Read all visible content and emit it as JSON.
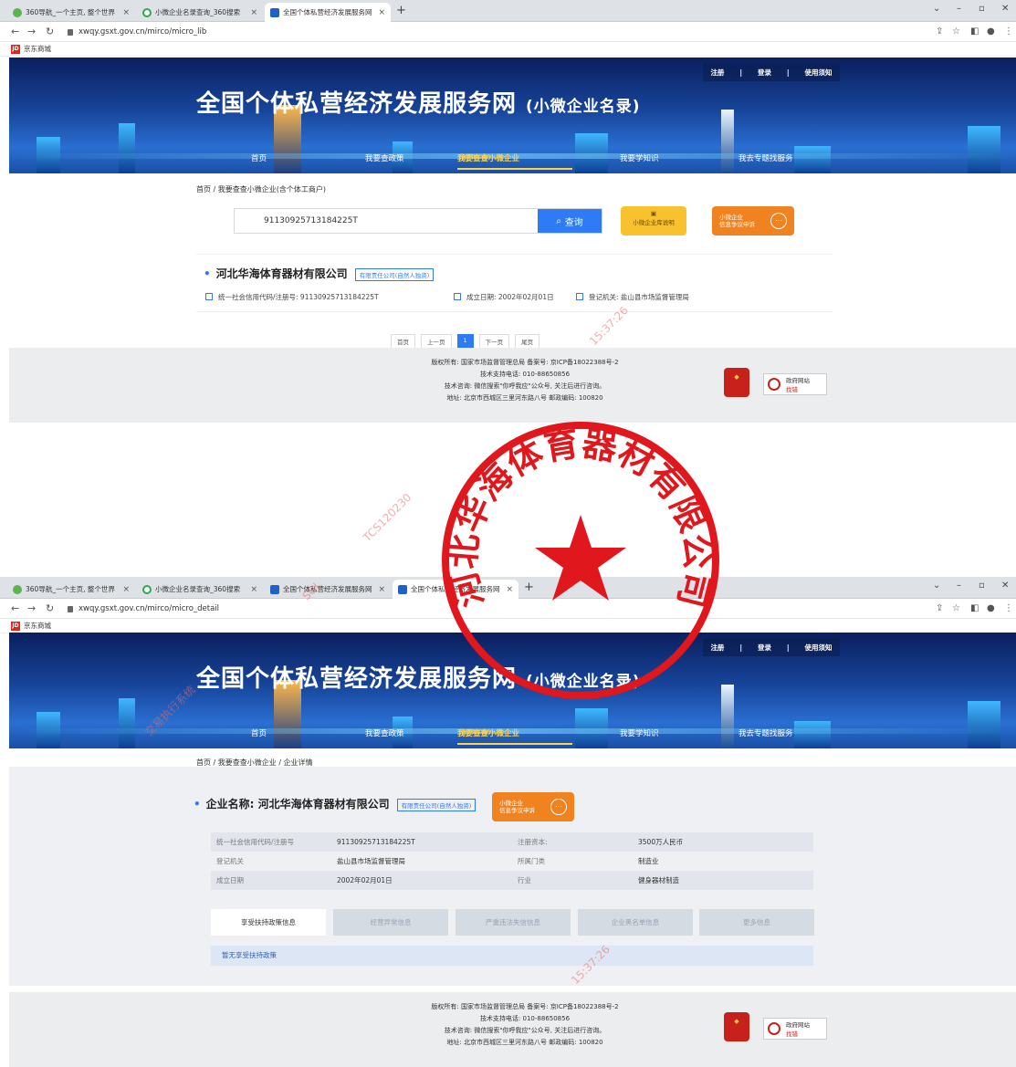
{
  "screen1": {
    "tabs": [
      {
        "title": "360导航_一个主页, 整个世界"
      },
      {
        "title": "小微企业名录查询_360搜索"
      },
      {
        "title": "全国个体私营经济发展服务网"
      }
    ],
    "url": "xwqy.gsxt.gov.cn/mirco/micro_lib",
    "breadcrumb": "首页 / 我要查查小微企业(含个体工商户)",
    "search_value": "91130925713184225T",
    "search_button": "查询",
    "lib_button": "小微企业库说明",
    "result": {
      "name": "河北华海体育器材有限公司",
      "tag": "有限责任公司(自然人独资)",
      "credit_code": "统一社会信用代码/注册号: 91130925713184225T",
      "founded": "成立日期: 2002年02月01日",
      "authority": "登记机关: 盐山县市场监督管理局"
    },
    "pager": {
      "first": "首页",
      "prev": "上一页",
      "current": "1",
      "next": "下一页",
      "last": "尾页"
    }
  },
  "screen2": {
    "tabs": [
      {
        "title": "360导航_一个主页, 整个世界"
      },
      {
        "title": "小微企业名录查询_360搜索"
      },
      {
        "title": "全国个体私营经济发展服务网"
      },
      {
        "title": "全国个体私营经济发展服务网"
      }
    ],
    "url": "xwqy.gsxt.gov.cn/mirco/micro_detail",
    "breadcrumb": "首页 / 我要查查小微企业 / 企业详情",
    "company_name": "企业名称: 河北华海体育器材有限公司",
    "tag": "有限责任公司(自然人独资)",
    "details": {
      "credit_label": "统一社会信用代码/注册号",
      "credit_value": "91130925713184225T",
      "capital_label": "注册资本:",
      "capital_value": "3500万人民币",
      "authority_label": "登记机关",
      "authority_value": "盐山县市场监督管理局",
      "category_label": "所属门类",
      "category_value": "制造业",
      "founded_label": "成立日期",
      "founded_value": "2002年02月01日",
      "industry_label": "行业",
      "industry_value": "健身器材制造"
    },
    "detail_tabs": [
      "享受扶持政策信息",
      "经营异常信息",
      "严重违法失信信息",
      "企业黑名单信息",
      "更多信息"
    ],
    "policy_empty": "暂无享受扶持政策"
  },
  "site": {
    "title": "全国个体私营经济发展服务网",
    "subtitle": "(小微企业名录)",
    "top_links": [
      "注册",
      "登录",
      "使用须知"
    ],
    "nav": [
      "首页",
      "我要查政策",
      "我要查查小微企业",
      "我要学知识",
      "我去专题找服务"
    ],
    "nav_small": "(含个体工商户)",
    "dispute_button": [
      "小微企业",
      "信息争议申诉"
    ],
    "bookmark": "京东商城"
  },
  "footer": {
    "lines": [
      "版权所有: 国家市场监督管理总局 备案号: 京ICP备18022388号-2",
      "技术支持电话: 010-88650856",
      "技术咨询: 微信搜索\"你呼我应\"公众号, 关注后进行咨询。",
      "地址: 北京市西城区三里河东路八号 邮政编码: 100820"
    ],
    "gov_site": [
      "政府网站",
      "找错"
    ]
  },
  "seal": {
    "text": "河北华海体育器材有限公司"
  },
  "watermarks": [
    "交易执行系统",
    "SGL",
    "TCS120230",
    "15:37:26"
  ],
  "colors": {
    "accent": "#2f7bf5",
    "nav_active": "#ffd24a",
    "seal_red": "#e0171c",
    "dispute": "#f08320"
  }
}
